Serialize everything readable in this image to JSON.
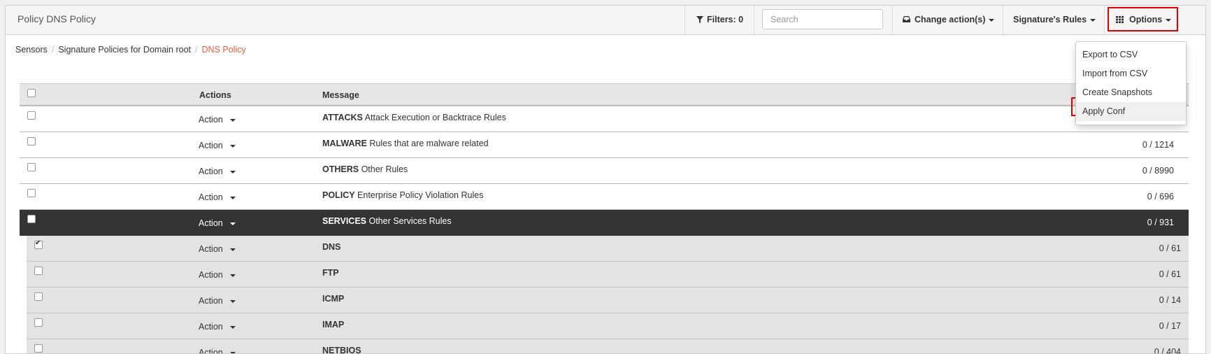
{
  "header": {
    "title": "Policy DNS Policy",
    "filters_label": "Filters: 0",
    "search_placeholder": "Search",
    "change_actions_label": "Change action(s)",
    "signature_rules_label": "Signature's Rules",
    "options_label": "Options"
  },
  "breadcrumb": [
    "Sensors",
    "Signature Policies for Domain root",
    "DNS Policy"
  ],
  "options_menu": {
    "items": [
      "Export to CSV",
      "Import from CSV",
      "Create Snapshots",
      "Apply Conf"
    ],
    "highlighted": "Apply Conf"
  },
  "table": {
    "columns": {
      "actions": "Actions",
      "message": "Message"
    },
    "action_label": "Action",
    "rows": [
      {
        "name": "ATTACKS",
        "desc": "Attack Execution or Backtrace Rules",
        "count": ""
      },
      {
        "name": "MALWARE",
        "desc": "Rules that are malware related",
        "count": "0 / 1214"
      },
      {
        "name": "OTHERS",
        "desc": "Other Rules",
        "count": "0 / 8990"
      },
      {
        "name": "POLICY",
        "desc": "Enterprise Policy Violation Rules",
        "count": "0 / 696"
      },
      {
        "name": "SERVICES",
        "desc": "Other Services Rules",
        "count": "0 / 931",
        "selected": true
      }
    ],
    "subrows": [
      {
        "name": "DNS",
        "count": "0 / 61",
        "checked": true
      },
      {
        "name": "FTP",
        "count": "0 / 61",
        "checked": false
      },
      {
        "name": "ICMP",
        "count": "0 / 14",
        "checked": false
      },
      {
        "name": "IMAP",
        "count": "0 / 17",
        "checked": false
      },
      {
        "name": "NETBIOS",
        "count": "0 / 404",
        "checked": false
      }
    ]
  },
  "colors": {
    "accent": "#e8603c",
    "highlight_box": "#e00000",
    "selected_row": "#333333"
  }
}
